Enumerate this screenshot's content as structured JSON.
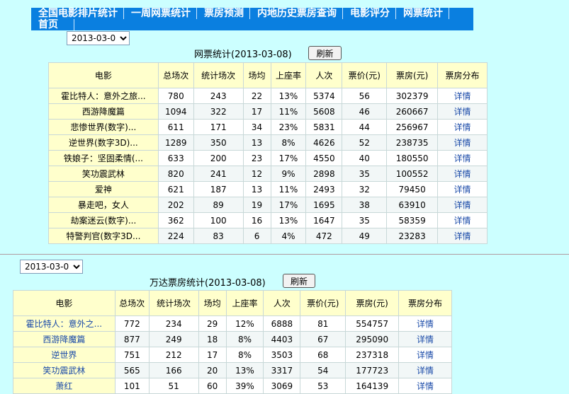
{
  "nav": {
    "items": [
      "全国电影排片统计",
      "一周网票统计",
      "票房预测",
      "内地历史票房查询",
      "电影评分",
      "网票统计"
    ],
    "home": "首页"
  },
  "section1": {
    "date": "2013-03-08",
    "title": "网票统计(2013-03-08)",
    "refresh": "刷新",
    "headers": [
      "电影",
      "总场次",
      "统计场次",
      "场均",
      "上座率",
      "人次",
      "票价(元)",
      "票房(元)",
      "票房分布"
    ],
    "rows": [
      [
        "霍比特人：意外之旅...",
        "780",
        "243",
        "22",
        "13%",
        "5374",
        "56",
        "302379",
        "详情"
      ],
      [
        "西游降魔篇",
        "1094",
        "322",
        "17",
        "11%",
        "5608",
        "46",
        "260667",
        "详情"
      ],
      [
        "悲惨世界(数字)...",
        "611",
        "171",
        "34",
        "23%",
        "5831",
        "44",
        "256967",
        "详情"
      ],
      [
        "逆世界(数字3D)...",
        "1289",
        "350",
        "13",
        "8%",
        "4626",
        "52",
        "238735",
        "详情"
      ],
      [
        "铁娘子：坚固柔情(...",
        "633",
        "200",
        "23",
        "17%",
        "4550",
        "40",
        "180550",
        "详情"
      ],
      [
        "笑功震武林",
        "820",
        "241",
        "12",
        "9%",
        "2898",
        "35",
        "100552",
        "详情"
      ],
      [
        "爱神",
        "621",
        "187",
        "13",
        "11%",
        "2493",
        "32",
        "79450",
        "详情"
      ],
      [
        "暴走吧，女人",
        "202",
        "89",
        "19",
        "17%",
        "1695",
        "38",
        "63910",
        "详情"
      ],
      [
        "劫案迷云(数字)...",
        "362",
        "100",
        "16",
        "13%",
        "1647",
        "35",
        "58359",
        "详情"
      ],
      [
        "特警判官(数字3D...",
        "224",
        "83",
        "6",
        "4%",
        "472",
        "49",
        "23283",
        "详情"
      ]
    ]
  },
  "section2": {
    "date": "2013-03-08",
    "title": "万达票房统计(2013-03-08)",
    "refresh": "刷新",
    "headers": [
      "电影",
      "总场次",
      "统计场次",
      "场均",
      "上座率",
      "人次",
      "票价(元)",
      "票房(元)",
      "票房分布"
    ],
    "rows": [
      [
        "霍比特人：意外之...",
        "772",
        "234",
        "29",
        "12%",
        "6888",
        "81",
        "554757",
        "详情"
      ],
      [
        "西游降魔篇",
        "877",
        "249",
        "18",
        "8%",
        "4403",
        "67",
        "295090",
        "详情"
      ],
      [
        "逆世界",
        "751",
        "212",
        "17",
        "8%",
        "3503",
        "68",
        "237318",
        "详情"
      ],
      [
        "笑功震武林",
        "565",
        "166",
        "20",
        "13%",
        "3317",
        "54",
        "177723",
        "详情"
      ],
      [
        "萧红",
        "101",
        "51",
        "60",
        "39%",
        "3069",
        "53",
        "164139",
        "详情"
      ]
    ]
  }
}
